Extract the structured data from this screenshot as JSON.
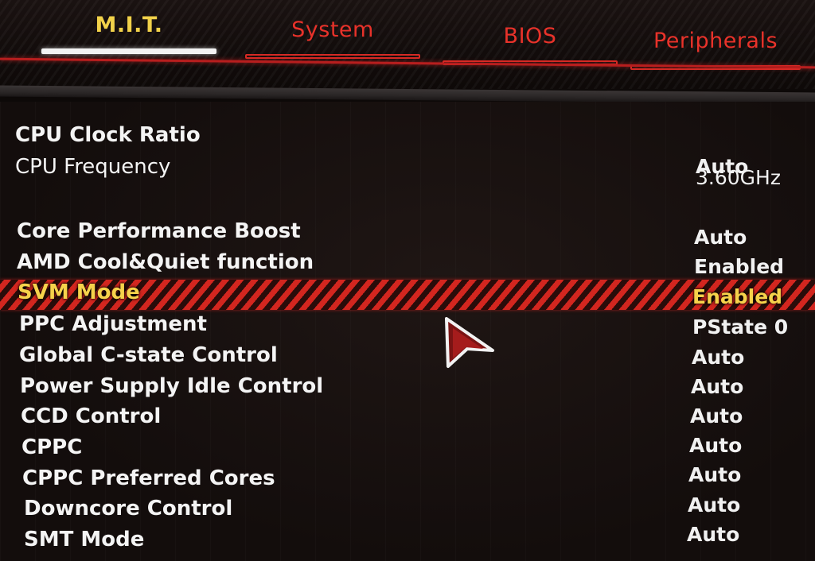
{
  "tabs": [
    {
      "label": "M.I.T."
    },
    {
      "label": "System"
    },
    {
      "label": "BIOS"
    },
    {
      "label": "Peripherals"
    }
  ],
  "settings": [
    {
      "label": "CPU Clock Ratio",
      "value": "Auto"
    },
    {
      "label": "CPU Frequency",
      "value": "3.60GHz"
    },
    {
      "label": "Core Performance Boost",
      "value": "Auto"
    },
    {
      "label": "AMD Cool&Quiet function",
      "value": "Enabled"
    },
    {
      "label": "SVM Mode",
      "value": "Enabled"
    },
    {
      "label": "PPC Adjustment",
      "value": "PState 0"
    },
    {
      "label": "Global C-state Control",
      "value": "Auto"
    },
    {
      "label": "Power Supply Idle Control",
      "value": "Auto"
    },
    {
      "label": "CCD Control",
      "value": "Auto"
    },
    {
      "label": "CPPC",
      "value": "Auto"
    },
    {
      "label": "CPPC Preferred Cores",
      "value": "Auto"
    },
    {
      "label": "Downcore Control",
      "value": "Auto"
    },
    {
      "label": "SMT Mode",
      "value": "Auto"
    }
  ],
  "colors": {
    "accent_red": "#d52a24",
    "active_tab_text": "#f2d24a",
    "selected_row_text": "#f6d24b",
    "background": "#130d0c"
  },
  "icons": {
    "cursor": "mouse-pointer-icon"
  }
}
